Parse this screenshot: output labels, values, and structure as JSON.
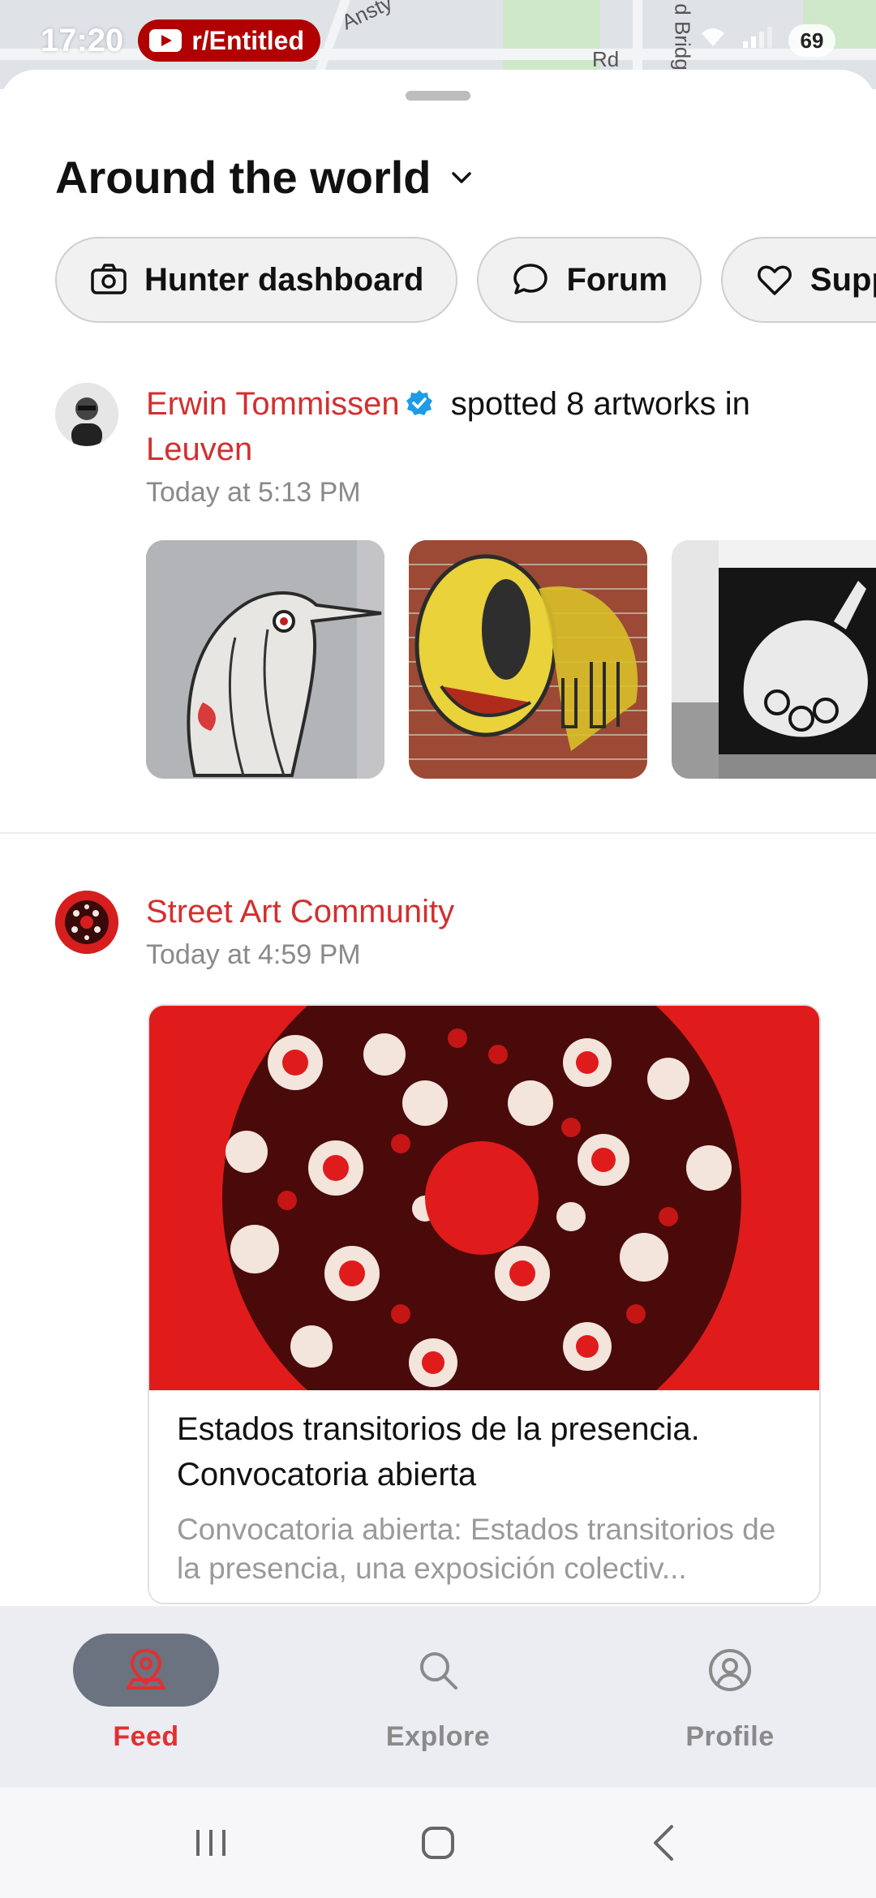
{
  "status_bar": {
    "time": "17:20",
    "notification_pill": "r/Entitled",
    "battery": "69"
  },
  "map": {
    "labels": [
      "Ansty",
      "Rd",
      "d Bridg"
    ]
  },
  "header": {
    "title": "Around the world"
  },
  "chips": [
    {
      "label": "Hunter dashboard",
      "icon": "camera-icon"
    },
    {
      "label": "Forum",
      "icon": "chat-bubble-icon"
    },
    {
      "label": "Suppo",
      "icon": "heart-icon"
    }
  ],
  "feed": [
    {
      "author": "Erwin Tommissen",
      "action": " spotted 8 artworks in ",
      "place": "Leuven",
      "timestamp": "Today at 5:13 PM"
    },
    {
      "author": "Street Art Community",
      "timestamp": "Today at 4:59 PM",
      "card": {
        "title": "Estados transitorios de la presencia. Convocatoria abierta",
        "description": "Convocatoria abierta: Estados transitorios de la presencia, una exposición colectiv..."
      }
    }
  ],
  "bottom_nav": {
    "tabs": [
      {
        "label": "Feed",
        "icon": "map-pin-icon",
        "active": true
      },
      {
        "label": "Explore",
        "icon": "search-icon",
        "active": false
      },
      {
        "label": "Profile",
        "icon": "user-circle-icon",
        "active": false
      }
    ]
  },
  "colors": {
    "accent": "#d32f2f",
    "active_tab_bg": "#6b7280",
    "nav_bg": "#ececf3"
  }
}
